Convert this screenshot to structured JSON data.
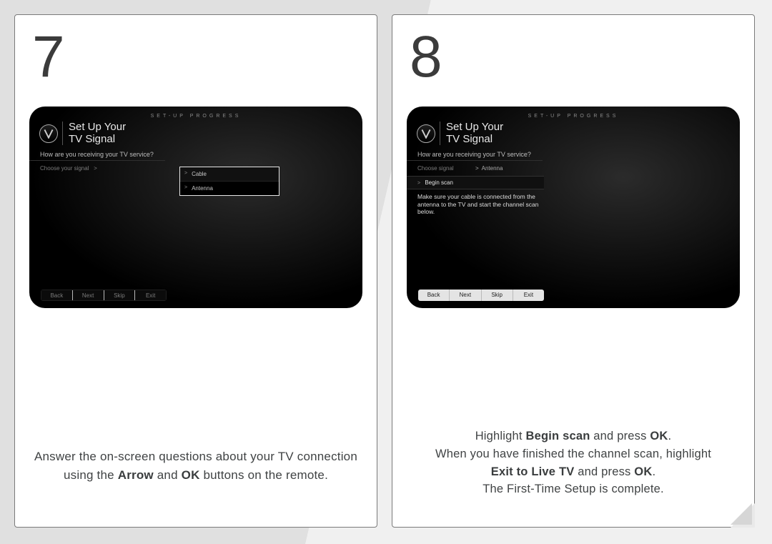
{
  "step7": {
    "number": "7",
    "tv": {
      "progress_label": "SET-UP PROGRESS",
      "title_l1": "Set Up Your",
      "title_l2": "TV Signal",
      "question": "How are you receiving your TV service?",
      "choose_label": "Choose your signal",
      "choose_arrow": ">",
      "popup_opt1": "Cable",
      "popup_opt2": "Antenna",
      "btn_back": "Back",
      "btn_next": "Next",
      "btn_skip": "Skip",
      "btn_exit": "Exit"
    },
    "caption_pre": "Answer the on-screen questions about your TV connection using the ",
    "caption_b1": "Arrow",
    "caption_mid": " and ",
    "caption_b2": "OK",
    "caption_post": " buttons on the remote."
  },
  "step8": {
    "number": "8",
    "tv": {
      "progress_label": "SET-UP PROGRESS",
      "title_l1": "Set Up Your",
      "title_l2": "TV Signal",
      "question": "How are you receiving your TV service?",
      "choose_label": "Choose signal",
      "choose_arrow": ">",
      "choose_value": "Antenna",
      "begin_arrow": ">",
      "begin_label": "Begin scan",
      "help": "Make sure your cable is connected from the antenna to the TV and start the channel scan below.",
      "btn_back": "Back",
      "btn_next": "Next",
      "btn_skip": "Skip",
      "btn_exit": "Exit"
    },
    "cap_l1_pre": "Highlight ",
    "cap_l1_b": "Begin scan",
    "cap_l1_mid": " and press ",
    "cap_l1_b2": "OK",
    "cap_l1_end": ".",
    "cap_l2": "When you have finished the channel scan, highlight",
    "cap_l3_b": "Exit to Live TV",
    "cap_l3_mid": " and press ",
    "cap_l3_b2": "OK",
    "cap_l3_end": ".",
    "cap_l4": "The First-Time Setup is complete."
  }
}
